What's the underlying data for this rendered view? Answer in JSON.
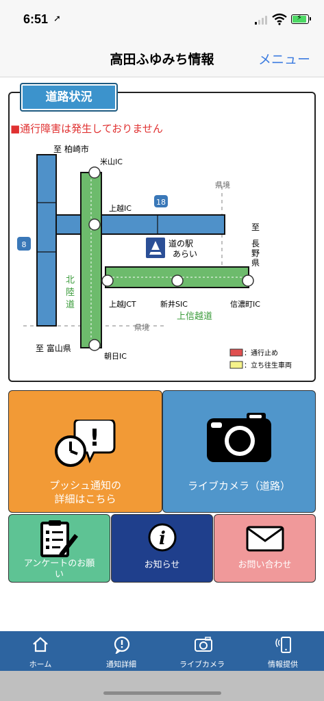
{
  "status_bar": {
    "time": "6:51"
  },
  "nav": {
    "title": "高田ふゆみち情報",
    "menu_label": "メニュー"
  },
  "road": {
    "tab_label": "道路状況",
    "status_text": "■通行障害は発生しておりません",
    "map": {
      "to_kashiwazaki": "至 柏崎市",
      "to_toyama": "至 富山県",
      "to_nagano": [
        "至",
        "長",
        "野",
        "県"
      ],
      "yoneyama_ic": "米山IC",
      "joetsu_ic": "上越IC",
      "joetsu_jct": "上越JCT",
      "arai_sic": "新井SIC",
      "shinanomachi_ic": "信濃町IC",
      "asahi_ic": "朝日IC",
      "hokuriku": [
        "北",
        "陸",
        "道"
      ],
      "joshinetsu": "上信越道",
      "kenkyo": "県境",
      "route_18": "18",
      "route_8": "8",
      "michi_no_eki": [
        "道の駅",
        "あらい"
      ],
      "legend_closed": "：通行止め",
      "legend_stuck": "：立ち往生車両"
    },
    "colors": {
      "green_road": "#6dbb6c",
      "blue_road": "#4f91c9",
      "closed": "#e05050",
      "stuck": "#f5f28a"
    }
  },
  "tiles": {
    "push": [
      "プッシュ通知の",
      "詳細はこちら"
    ],
    "camera": "ライブカメラ（道路）",
    "survey": [
      "アンケートのお願",
      "い"
    ],
    "notice": "お知らせ",
    "contact": "お問い合わせ"
  },
  "tabbar": {
    "home": "ホーム",
    "notification_detail": "通知詳細",
    "live_camera": "ライブカメラ",
    "info_provide": "情報提供"
  }
}
